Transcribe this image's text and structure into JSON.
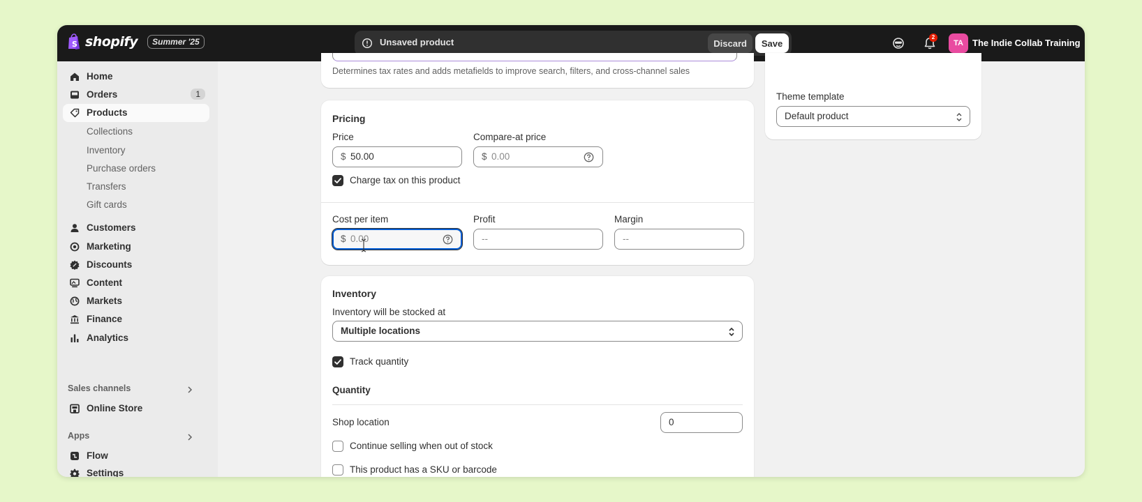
{
  "topbar": {
    "brand": "shopify",
    "edition": "Summer '25",
    "unsaved_text": "Unsaved product",
    "discard_label": "Discard",
    "save_label": "Save",
    "notification_count": "2",
    "avatar_initials": "TA",
    "store_name": "The Indie Collab Training ..."
  },
  "sidebar": {
    "home": "Home",
    "orders": "Orders",
    "orders_count": "1",
    "products": "Products",
    "sub": {
      "collections": "Collections",
      "inventory": "Inventory",
      "purchase_orders": "Purchase orders",
      "transfers": "Transfers",
      "gift_cards": "Gift cards"
    },
    "customers": "Customers",
    "marketing": "Marketing",
    "discounts": "Discounts",
    "content": "Content",
    "markets": "Markets",
    "finance": "Finance",
    "analytics": "Analytics",
    "sales_channels": "Sales channels",
    "online_store": "Online Store",
    "apps": "Apps",
    "flow": "Flow",
    "settings": "Settings"
  },
  "category_card": {
    "help_text": "Determines tax rates and adds metafields to improve search, filters, and cross-channel sales"
  },
  "pricing": {
    "title": "Pricing",
    "price_label": "Price",
    "price_currency": "$",
    "price_value": "50.00",
    "compare_label": "Compare-at price",
    "compare_currency": "$",
    "compare_placeholder": "0.00",
    "charge_tax_label": "Charge tax on this product",
    "cost_label": "Cost per item",
    "cost_currency": "$",
    "cost_placeholder": "0.00",
    "profit_label": "Profit",
    "profit_value": "--",
    "margin_label": "Margin",
    "margin_value": "--"
  },
  "inventory": {
    "title": "Inventory",
    "stocked_label": "Inventory will be stocked at",
    "location_select": "Multiple locations",
    "track_label": "Track quantity",
    "quantity_title": "Quantity",
    "shop_location_label": "Shop location",
    "shop_location_value": "0",
    "continue_selling_label": "Continue selling when out of stock",
    "sku_label": "This product has a SKU or barcode"
  },
  "theme": {
    "label": "Theme template",
    "value": "Default product"
  },
  "colors": {
    "page_bg": "#e6f7c9",
    "topbar": "#1a1a1a",
    "avatar": "#e94ba0",
    "badge": "#e51c00",
    "focus": "#005bd3"
  }
}
